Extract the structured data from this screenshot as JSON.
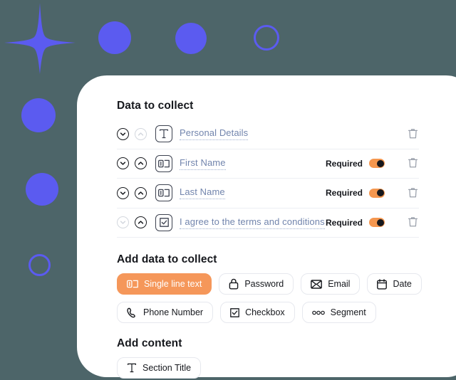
{
  "theme": {
    "background": "#4d6569",
    "card_background": "#ffffff",
    "accent_orange": "#f5975a",
    "decor_blue": "#5b5bf0",
    "label_blue": "#7285ad",
    "text_dark": "#16181d"
  },
  "decor": {
    "sparkle": "sparkle-star",
    "shapes": [
      {
        "name": "circle-solid-top-1",
        "type": "solid"
      },
      {
        "name": "circle-solid-top-2",
        "type": "solid"
      },
      {
        "name": "circle-outline-top",
        "type": "ring"
      },
      {
        "name": "circle-solid-left-1",
        "type": "solid"
      },
      {
        "name": "circle-solid-left-2",
        "type": "solid"
      },
      {
        "name": "circle-outline-left",
        "type": "ring"
      }
    ]
  },
  "card": {
    "data_to_collect": {
      "heading": "Data to collect",
      "rows": [
        {
          "label": "Personal Details",
          "icon": "text-title-icon",
          "move_down_enabled": true,
          "move_up_enabled": false,
          "has_required": false,
          "required_label": "",
          "required_on": false
        },
        {
          "label": "First Name",
          "icon": "single-line-text-icon",
          "move_down_enabled": true,
          "move_up_enabled": true,
          "has_required": true,
          "required_label": "Required",
          "required_on": true
        },
        {
          "label": "Last Name",
          "icon": "single-line-text-icon",
          "move_down_enabled": true,
          "move_up_enabled": true,
          "has_required": true,
          "required_label": "Required",
          "required_on": true
        },
        {
          "label": "I agree to the terms and conditions",
          "icon": "checkbox-icon",
          "move_down_enabled": false,
          "move_up_enabled": true,
          "has_required": true,
          "required_label": "Required",
          "required_on": true
        }
      ]
    },
    "add_data_to_collect": {
      "heading": "Add data to collect",
      "chips": [
        [
          {
            "label": "Single line text",
            "icon": "single-line-text-icon",
            "active": true
          },
          {
            "label": "Password",
            "icon": "lock-icon",
            "active": false
          },
          {
            "label": "Email",
            "icon": "envelope-icon",
            "active": false
          },
          {
            "label": "Date",
            "icon": "calendar-icon",
            "active": false
          }
        ],
        [
          {
            "label": "Phone Number",
            "icon": "phone-icon",
            "active": false
          },
          {
            "label": "Checkbox",
            "icon": "checkbox-icon",
            "active": false
          },
          {
            "label": "Segment",
            "icon": "segment-dots-icon",
            "active": false
          }
        ]
      ]
    },
    "add_content": {
      "heading": "Add content",
      "chips": [
        [
          {
            "label": "Section Title",
            "icon": "text-title-icon",
            "active": false
          }
        ]
      ]
    }
  }
}
